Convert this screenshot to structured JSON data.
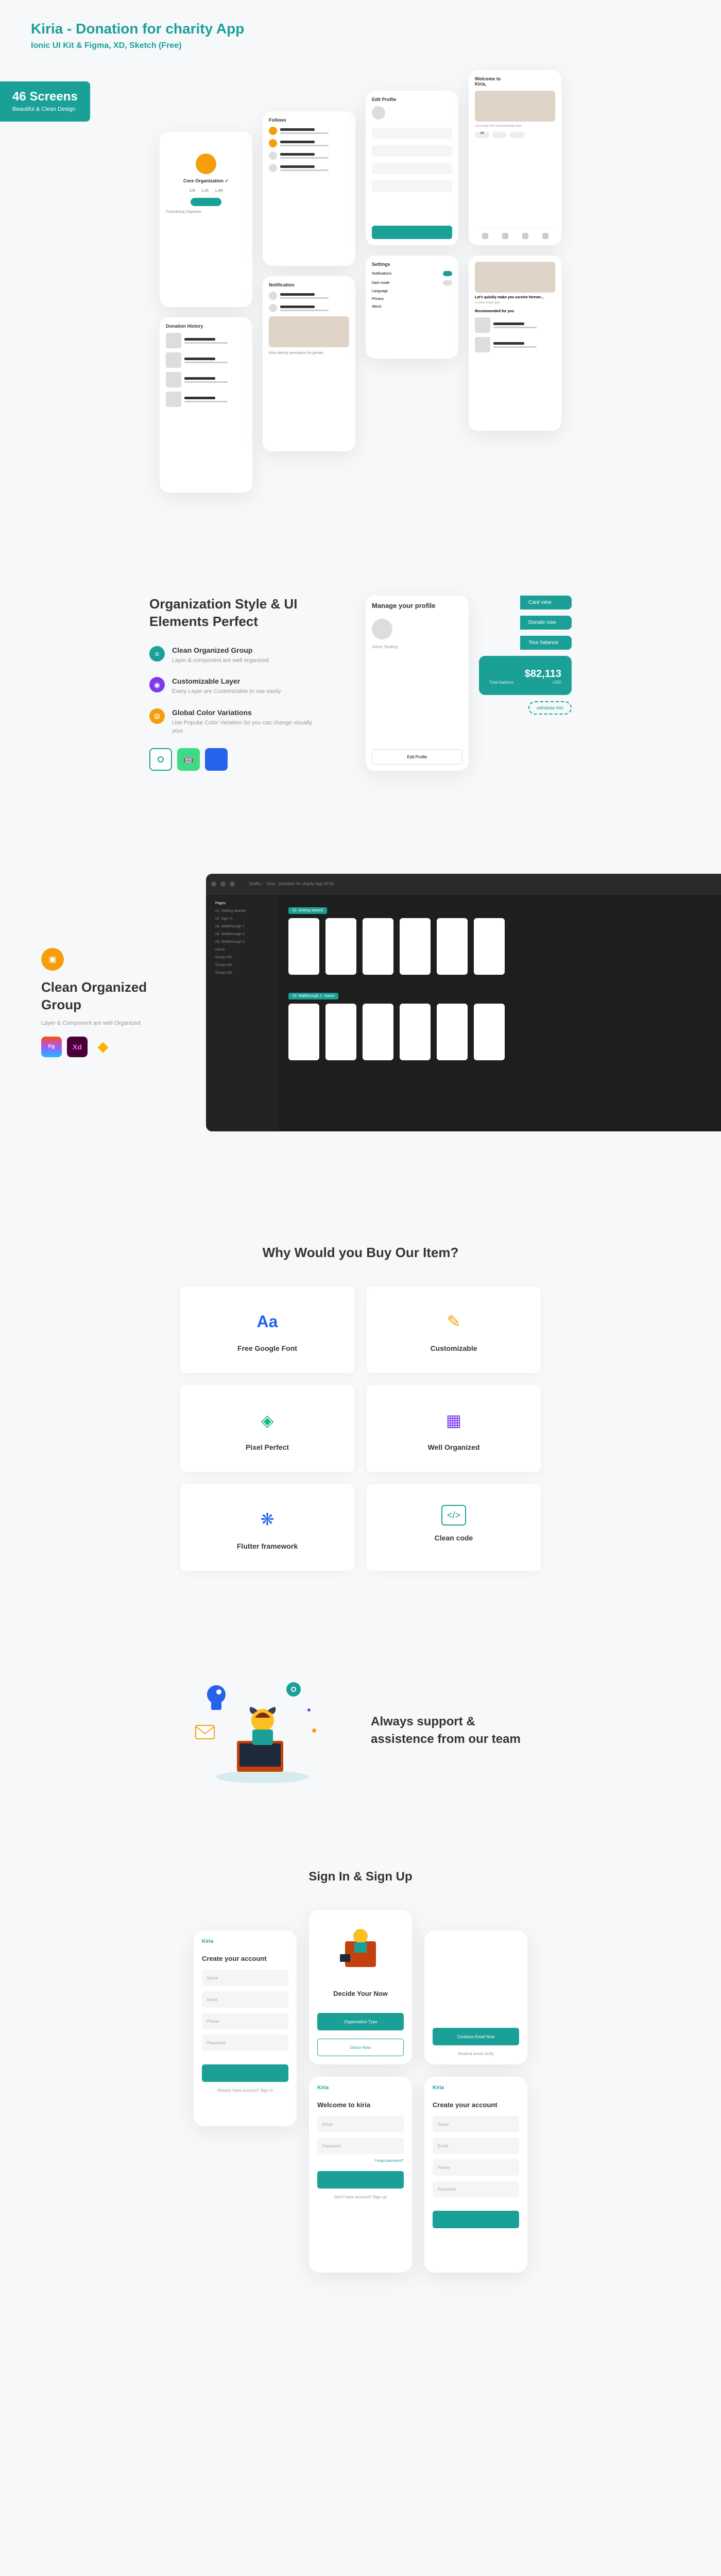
{
  "header": {
    "title": "Kiria - Donation for charity App",
    "subtitle": "Ionic UI Kit & Figma, XD, Sketch (Free)",
    "badge_count": "46 Screens",
    "badge_text": "Beautiful & Clean Design"
  },
  "org": {
    "heading": "Organization Style & UI Elements Perfect",
    "items": [
      {
        "title": "Clean Organized Group",
        "desc": "Layer & component are well organized",
        "color": "#1ba098"
      },
      {
        "title": "Customizable Layer",
        "desc": "Every Layer are Customizable to use easily",
        "color": "#7c3aed"
      },
      {
        "title": "Global Color Variations",
        "desc": "Use Popular Color Variation So you can change visually your",
        "color": "#f59e0b"
      }
    ],
    "profile_phone": {
      "title": "Manage your profile",
      "btn": "Edit Profile"
    },
    "card": {
      "label": "Total balance",
      "amount": "$82,113",
      "sub": "withdraw this"
    },
    "stack_btns": [
      "Card view",
      "Donate now",
      "Your balance"
    ]
  },
  "clean": {
    "heading": "Clean Organized Group",
    "desc": "Layer & Component are well Organized",
    "editor_tab": "Kiria - Donation for charity App UI Kit",
    "sidebar_items": [
      "Pages",
      "01. Getting Started",
      "02. Sign In",
      "03. Walkthrough 1",
      "04. Walkthrough 2",
      "05. Walkthrough 3",
      "Home",
      "Group 550",
      "Group 540",
      "Group 530"
    ],
    "canvas_labels": [
      "01. Getting Started",
      "02. Walkthrough 1 - Name"
    ]
  },
  "why": {
    "heading": "Why Would you Buy Our Item?",
    "cards": [
      {
        "title": "Free Google Font",
        "icon_text": "Aa",
        "color": "#2563eb"
      },
      {
        "title": "Customizable",
        "icon_text": "✎",
        "color": "#f59e0b"
      },
      {
        "title": "Pixel Perfect",
        "icon_text": "◈",
        "color": "#10b981"
      },
      {
        "title": "Well Organized",
        "icon_text": "▦",
        "color": "#7c3aed"
      },
      {
        "title": "Flutter framework",
        "icon_text": "❋",
        "color": "#2563eb"
      },
      {
        "title": "Clean code",
        "icon_text": "</>",
        "color": "#1ba098"
      }
    ]
  },
  "support": {
    "heading": "Always support & assistence from our team"
  },
  "signin": {
    "heading": "Sign In & Sign Up",
    "phones": {
      "create1": {
        "logo": "Kiria",
        "title": "Create your account",
        "fields": [
          "Name",
          "Email",
          "Phone",
          "Password"
        ],
        "link": "Already have account? Sign in"
      },
      "decide": {
        "title": "Decide Your Now",
        "btn1": "Organization Type",
        "btn2": "Donor Now"
      },
      "welcome": {
        "logo": "Kiria",
        "title": "Welcome to kiria",
        "fields": [
          "Email",
          "Password"
        ],
        "forgot": "Forgot password?",
        "signup": "Don't have account? Sign up"
      },
      "verify": {
        "btn": "Continue Email Now",
        "link": "Resend email verify"
      },
      "create2": {
        "logo": "Kiria",
        "title": "Create your account",
        "fields": [
          "Name",
          "Email",
          "Phone",
          "Password"
        ]
      }
    }
  },
  "colors": {
    "teal": "#1ba098",
    "orange": "#f59e0b",
    "purple": "#7c3aed",
    "blue": "#2563eb"
  }
}
